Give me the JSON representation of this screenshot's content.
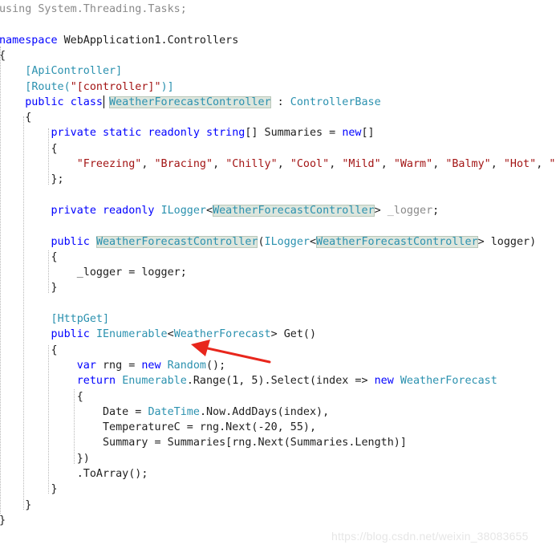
{
  "editor": {
    "lines": [
      [
        {
          "t": "using",
          "c": "gr"
        },
        {
          "t": " System.Threading.Tasks;",
          "c": "gr"
        }
      ],
      [],
      [
        {
          "t": "namespace",
          "c": "kw"
        },
        {
          "t": " WebApplication1.Controllers"
        }
      ],
      [
        {
          "t": "{"
        }
      ],
      [
        {
          "t": "    "
        },
        {
          "t": "[",
          "c": "ty"
        },
        {
          "t": "ApiController",
          "c": "ty"
        },
        {
          "t": "]",
          "c": "ty"
        }
      ],
      [
        {
          "t": "    "
        },
        {
          "t": "[",
          "c": "ty"
        },
        {
          "t": "Route",
          "c": "ty"
        },
        {
          "t": "(",
          "c": "ty"
        },
        {
          "t": "\"[controller]\"",
          "c": "st"
        },
        {
          "t": ")]",
          "c": "ty"
        }
      ],
      [
        {
          "t": "    "
        },
        {
          "t": "public",
          "c": "kw"
        },
        {
          "t": " "
        },
        {
          "t": "class",
          "c": "kw"
        },
        {
          "t": " "
        },
        {
          "t": "WeatherForecastController",
          "c": "ty",
          "hl": true
        },
        {
          "t": " : "
        },
        {
          "t": "ControllerBase",
          "c": "ty"
        }
      ],
      [
        {
          "t": "    {"
        }
      ],
      [
        {
          "t": "        "
        },
        {
          "t": "private",
          "c": "kw"
        },
        {
          "t": " "
        },
        {
          "t": "static",
          "c": "kw"
        },
        {
          "t": " "
        },
        {
          "t": "readonly",
          "c": "kw"
        },
        {
          "t": " "
        },
        {
          "t": "string",
          "c": "kw"
        },
        {
          "t": "[] Summaries = "
        },
        {
          "t": "new",
          "c": "kw"
        },
        {
          "t": "[]"
        }
      ],
      [
        {
          "t": "        {"
        }
      ],
      [
        {
          "t": "            "
        },
        {
          "t": "\"Freezing\"",
          "c": "st"
        },
        {
          "t": ", "
        },
        {
          "t": "\"Bracing\"",
          "c": "st"
        },
        {
          "t": ", "
        },
        {
          "t": "\"Chilly\"",
          "c": "st"
        },
        {
          "t": ", "
        },
        {
          "t": "\"Cool\"",
          "c": "st"
        },
        {
          "t": ", "
        },
        {
          "t": "\"Mild\"",
          "c": "st"
        },
        {
          "t": ", "
        },
        {
          "t": "\"Warm\"",
          "c": "st"
        },
        {
          "t": ", "
        },
        {
          "t": "\"Balmy\"",
          "c": "st"
        },
        {
          "t": ", "
        },
        {
          "t": "\"Hot\"",
          "c": "st"
        },
        {
          "t": ", "
        },
        {
          "t": "\"Swe",
          "c": "st"
        }
      ],
      [
        {
          "t": "        };"
        }
      ],
      [],
      [
        {
          "t": "        "
        },
        {
          "t": "private",
          "c": "kw"
        },
        {
          "t": " "
        },
        {
          "t": "readonly",
          "c": "kw"
        },
        {
          "t": " "
        },
        {
          "t": "ILogger",
          "c": "ty"
        },
        {
          "t": "<"
        },
        {
          "t": "WeatherForecastController",
          "c": "ty",
          "hl": true
        },
        {
          "t": "> "
        },
        {
          "t": "_logger",
          "c": "gr"
        },
        {
          "t": ";"
        }
      ],
      [],
      [
        {
          "t": "        "
        },
        {
          "t": "public",
          "c": "kw"
        },
        {
          "t": " "
        },
        {
          "t": "WeatherForecastController",
          "c": "ty",
          "hl": true
        },
        {
          "t": "("
        },
        {
          "t": "ILogger",
          "c": "ty"
        },
        {
          "t": "<"
        },
        {
          "t": "WeatherForecastController",
          "c": "ty",
          "hl": true
        },
        {
          "t": "> logger)"
        }
      ],
      [
        {
          "t": "        {"
        }
      ],
      [
        {
          "t": "            _logger = logger;"
        }
      ],
      [
        {
          "t": "        }"
        }
      ],
      [],
      [
        {
          "t": "        "
        },
        {
          "t": "[",
          "c": "ty"
        },
        {
          "t": "HttpGet",
          "c": "ty"
        },
        {
          "t": "]",
          "c": "ty"
        }
      ],
      [
        {
          "t": "        "
        },
        {
          "t": "public",
          "c": "kw"
        },
        {
          "t": " "
        },
        {
          "t": "IEnumerable",
          "c": "ty"
        },
        {
          "t": "<"
        },
        {
          "t": "WeatherForecast",
          "c": "ty"
        },
        {
          "t": "> Get()"
        }
      ],
      [
        {
          "t": "        {"
        }
      ],
      [
        {
          "t": "            "
        },
        {
          "t": "var",
          "c": "kw"
        },
        {
          "t": " rng = "
        },
        {
          "t": "new",
          "c": "kw"
        },
        {
          "t": " "
        },
        {
          "t": "Random",
          "c": "ty"
        },
        {
          "t": "();"
        }
      ],
      [
        {
          "t": "            "
        },
        {
          "t": "return",
          "c": "kw"
        },
        {
          "t": " "
        },
        {
          "t": "Enumerable",
          "c": "ty"
        },
        {
          "t": ".Range(1, 5).Select(index => "
        },
        {
          "t": "new",
          "c": "kw"
        },
        {
          "t": " "
        },
        {
          "t": "WeatherForecast",
          "c": "ty"
        }
      ],
      [
        {
          "t": "            {"
        }
      ],
      [
        {
          "t": "                Date = "
        },
        {
          "t": "DateTime",
          "c": "ty"
        },
        {
          "t": ".Now.AddDays(index),"
        }
      ],
      [
        {
          "t": "                TemperatureC = rng.Next(-20, 55),"
        }
      ],
      [
        {
          "t": "                Summary = Summaries[rng.Next(Summaries.Length)]"
        }
      ],
      [
        {
          "t": "            })"
        }
      ],
      [
        {
          "t": "            .ToArray();"
        }
      ],
      [
        {
          "t": "        }"
        }
      ],
      [
        {
          "t": "    }"
        }
      ],
      [
        {
          "t": "}"
        }
      ]
    ]
  },
  "watermark": "https://blog.csdn.net/weixin_38083655",
  "colors": {
    "keyword": "#0000ff",
    "type": "#2b91af",
    "string": "#a31515",
    "annotation_arrow": "#e8261c"
  }
}
